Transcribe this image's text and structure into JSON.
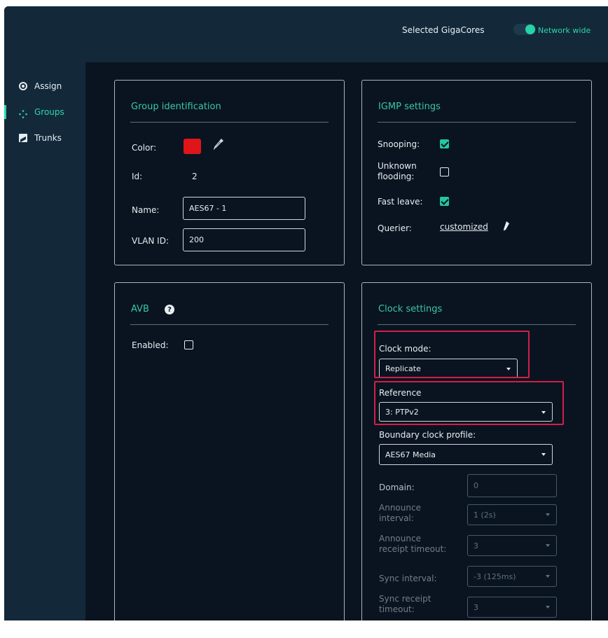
{
  "header": {
    "title": "Selected GigaCores",
    "scope_label": "Network wide",
    "toggle_on": true,
    "accent": "#2fd6a8"
  },
  "sidebar": {
    "items": [
      {
        "label": "Assign",
        "icon": "target-icon",
        "active": false
      },
      {
        "label": "Groups",
        "icon": "groups-icon",
        "active": true
      },
      {
        "label": "Trunks",
        "icon": "trunks-icon",
        "active": false
      }
    ]
  },
  "group_identification": {
    "title": "Group identification",
    "color_label": "Color:",
    "color_value": "#e0141b",
    "id_label": "Id:",
    "id_value": "2",
    "name_label": "Name:",
    "name_value": "AES67 - 1",
    "vlan_label": "VLAN ID:",
    "vlan_value": "200"
  },
  "igmp": {
    "title": "IGMP settings",
    "snooping_label": "Snooping:",
    "snooping_checked": true,
    "unknown_label_1": "Unknown",
    "unknown_label_2": "flooding:",
    "unknown_checked": false,
    "fast_leave_label": "Fast leave:",
    "fast_leave_checked": true,
    "querier_label": "Querier:",
    "querier_value": "customized"
  },
  "avb": {
    "title": "AVB",
    "enabled_label": "Enabled:",
    "enabled_checked": false
  },
  "clock": {
    "title": "Clock settings",
    "mode_label": "Clock mode:",
    "mode_value": "Replicate",
    "reference_label": "Reference",
    "reference_value": "3: PTPv2",
    "profile_label": "Boundary clock profile:",
    "profile_value": "AES67 Media",
    "domain_label": "Domain:",
    "domain_value": "0",
    "announce_interval_label_1": "Announce",
    "announce_interval_label_2": "interval:",
    "announce_interval_value": "1 (2s)",
    "announce_timeout_label_1": "Announce",
    "announce_timeout_label_2": "receipt timeout:",
    "announce_timeout_value": "3",
    "sync_interval_label": "Sync interval:",
    "sync_interval_value": "-3 (125ms)",
    "sync_timeout_label_1": "Sync receipt",
    "sync_timeout_label_2": "timeout:",
    "sync_timeout_value": "3"
  }
}
